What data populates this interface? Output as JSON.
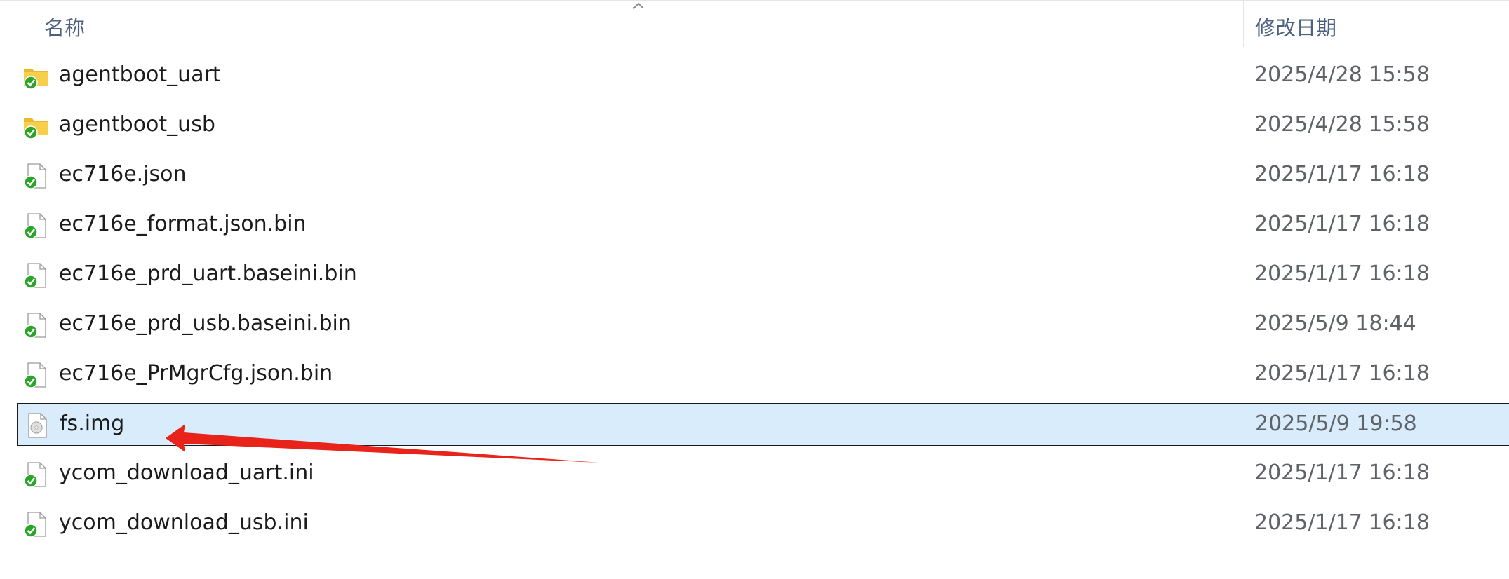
{
  "header": {
    "name_label": "名称",
    "date_label": "修改日期"
  },
  "files": [
    {
      "name": "agentboot_uart",
      "date": "2025/4/28 15:58",
      "type": "folder",
      "icon": "synced-folder-icon",
      "selected": false
    },
    {
      "name": "agentboot_usb",
      "date": "2025/4/28 15:58",
      "type": "folder",
      "icon": "synced-folder-icon",
      "selected": false
    },
    {
      "name": "ec716e.json",
      "date": "2025/1/17 16:18",
      "type": "file",
      "icon": "synced-file-icon",
      "selected": false
    },
    {
      "name": "ec716e_format.json.bin",
      "date": "2025/1/17 16:18",
      "type": "file",
      "icon": "synced-file-icon",
      "selected": false
    },
    {
      "name": "ec716e_prd_uart.baseini.bin",
      "date": "2025/1/17 16:18",
      "type": "file",
      "icon": "synced-file-icon",
      "selected": false
    },
    {
      "name": "ec716e_prd_usb.baseini.bin",
      "date": "2025/5/9 18:44",
      "type": "file",
      "icon": "synced-file-icon",
      "selected": false
    },
    {
      "name": "ec716e_PrMgrCfg.json.bin",
      "date": "2025/1/17 16:18",
      "type": "file",
      "icon": "synced-file-icon",
      "selected": false
    },
    {
      "name": "fs.img",
      "date": "2025/5/9 19:58",
      "type": "disk-image",
      "icon": "disc-image-icon",
      "selected": true
    },
    {
      "name": "ycom_download_uart.ini",
      "date": "2025/1/17 16:18",
      "type": "file",
      "icon": "synced-file-icon",
      "selected": false
    },
    {
      "name": "ycom_download_usb.ini",
      "date": "2025/1/17 16:18",
      "type": "file",
      "icon": "synced-file-icon",
      "selected": false
    }
  ],
  "colors": {
    "selection_bg": "#d9ecfc",
    "arrow": "#e8231a",
    "sync_green": "#2aa52a",
    "folder_yellow": "#f8cf4a"
  }
}
